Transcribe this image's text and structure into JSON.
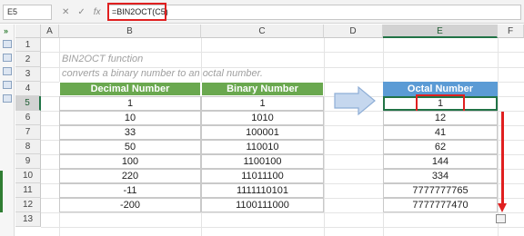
{
  "formula_bar": {
    "name_box": "E5",
    "formula": "=BIN2OCT(C5)"
  },
  "columns": [
    "A",
    "B",
    "C",
    "D",
    "E",
    "F"
  ],
  "rows": [
    "1",
    "2",
    "3",
    "4",
    "5",
    "6",
    "7",
    "8",
    "9",
    "10",
    "11",
    "12",
    "13"
  ],
  "sheet": {
    "subtitle_line1": "BIN2OCT  function",
    "subtitle_line2": "converts a binary number to an octal number.",
    "headers": {
      "decimal": "Decimal Number",
      "binary": "Binary Number",
      "octal": "Octal Number"
    },
    "table": [
      {
        "decimal": "1",
        "binary": "1",
        "octal": "1"
      },
      {
        "decimal": "10",
        "binary": "1010",
        "octal": "12"
      },
      {
        "decimal": "33",
        "binary": "100001",
        "octal": "41"
      },
      {
        "decimal": "50",
        "binary": "110010",
        "octal": "62"
      },
      {
        "decimal": "100",
        "binary": "1100100",
        "octal": "144"
      },
      {
        "decimal": "220",
        "binary": "11011100",
        "octal": "334"
      },
      {
        "decimal": "-11",
        "binary": "1111110101",
        "octal": "7777777765"
      },
      {
        "decimal": "-200",
        "binary": "1100111000",
        "octal": "7777777470"
      }
    ]
  },
  "colors": {
    "header_green": "#6aa84f",
    "header_blue": "#5b9bd5",
    "annotation_red": "#e02020",
    "selection_green": "#217346"
  },
  "icons": [
    "cancel-icon",
    "enter-icon",
    "fx-icon",
    "arrow-right-icon",
    "autofill-options-icon"
  ]
}
